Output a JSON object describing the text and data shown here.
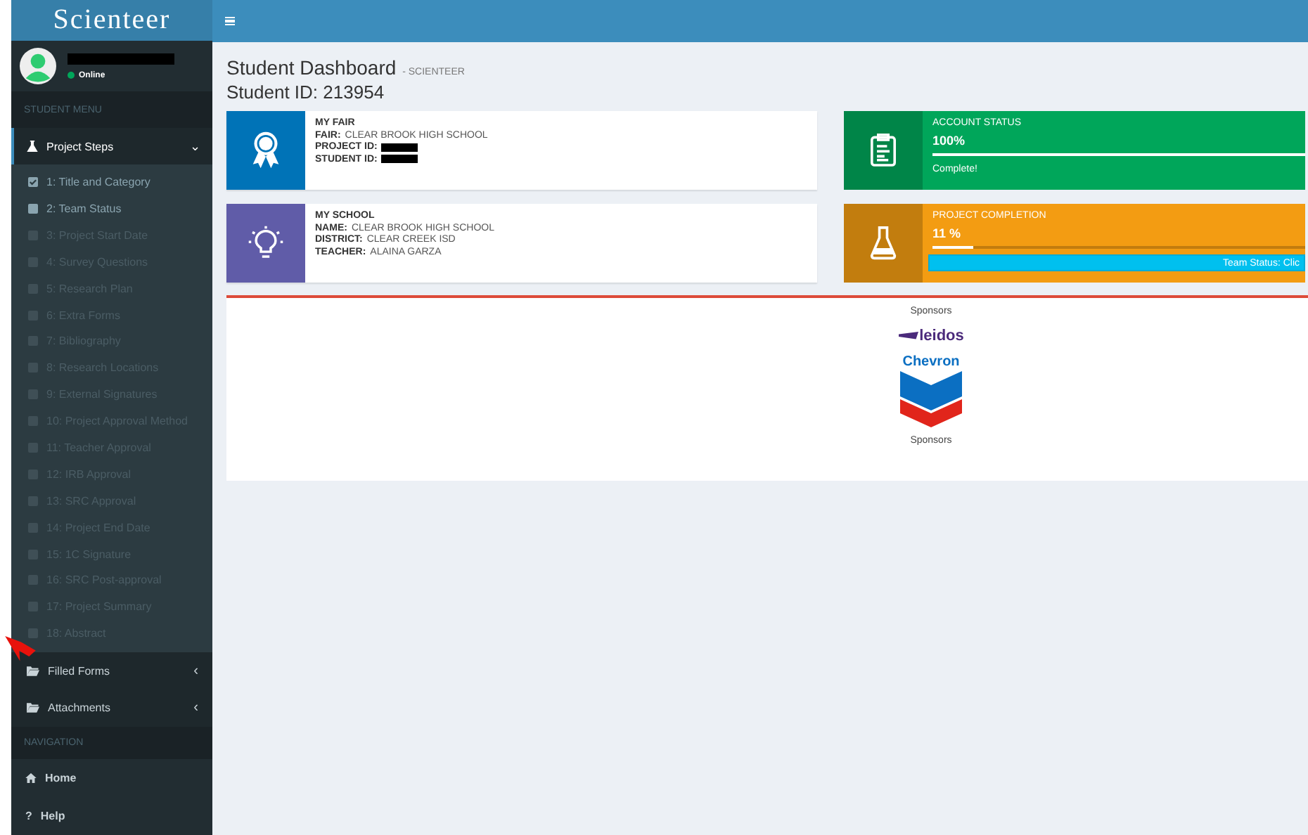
{
  "brand": "Scienteer",
  "user": {
    "status": "Online"
  },
  "sidebar": {
    "menu_header": "STUDENT MENU",
    "group": {
      "label": "Project Steps",
      "expanded": true,
      "caret": "⌄"
    },
    "steps": [
      {
        "label": "1: Title and Category",
        "checked": true,
        "disabled": false
      },
      {
        "label": "2: Team Status",
        "checked": false,
        "disabled": false
      },
      {
        "label": "3: Project Start Date",
        "checked": false,
        "disabled": true
      },
      {
        "label": "4: Survey Questions",
        "checked": false,
        "disabled": true
      },
      {
        "label": "5: Research Plan",
        "checked": false,
        "disabled": true
      },
      {
        "label": "6: Extra Forms",
        "checked": false,
        "disabled": true
      },
      {
        "label": "7: Bibliography",
        "checked": false,
        "disabled": true
      },
      {
        "label": "8: Research Locations",
        "checked": false,
        "disabled": true
      },
      {
        "label": "9: External Signatures",
        "checked": false,
        "disabled": true
      },
      {
        "label": "10: Project Approval Method",
        "checked": false,
        "disabled": true
      },
      {
        "label": "11: Teacher Approval",
        "checked": false,
        "disabled": true
      },
      {
        "label": "12: IRB Approval",
        "checked": false,
        "disabled": true
      },
      {
        "label": "13: SRC Approval",
        "checked": false,
        "disabled": true
      },
      {
        "label": "14: Project End Date",
        "checked": false,
        "disabled": true
      },
      {
        "label": "15: 1C Signature",
        "checked": false,
        "disabled": true
      },
      {
        "label": "16: SRC Post-approval",
        "checked": false,
        "disabled": true
      },
      {
        "label": "17: Project Summary",
        "checked": false,
        "disabled": true
      },
      {
        "label": "18: Abstract",
        "checked": false,
        "disabled": true
      }
    ],
    "folders": [
      {
        "label": "Filled Forms",
        "caret": "‹"
      },
      {
        "label": "Attachments",
        "caret": "‹"
      }
    ],
    "nav_header": "NAVIGATION",
    "nav": [
      {
        "kind": "home",
        "label": "Home"
      },
      {
        "kind": "help",
        "icon": "?",
        "label": "Help"
      }
    ]
  },
  "page": {
    "title": "Student Dashboard",
    "subtitle": "- SCIENTEER",
    "student_id_label": "Student ID:",
    "student_id": "213954"
  },
  "info_boxes": [
    {
      "kind": "fair",
      "color": "#0073b7",
      "title": "MY FAIR",
      "lines": [
        {
          "label": "FAIR:",
          "value": "CLEAR BROOK HIGH SCHOOL"
        },
        {
          "label": "PROJECT ID:",
          "redacted": true
        },
        {
          "label": "STUDENT ID:",
          "redacted": true
        }
      ]
    },
    {
      "kind": "school",
      "color": "#605ca8",
      "title": "MY SCHOOL",
      "lines": [
        {
          "label": "NAME:",
          "value": "CLEAR BROOK HIGH SCHOOL"
        },
        {
          "label": "DISTRICT:",
          "value": "CLEAR CREEK ISD"
        },
        {
          "label": "TEACHER:",
          "value": "ALAINA GARZA"
        }
      ]
    }
  ],
  "status_boxes": [
    {
      "kind": "clipboard",
      "color": "#00a65a",
      "title": "ACCOUNT STATUS",
      "value": "100%",
      "level": 1,
      "footer": "Complete!"
    },
    {
      "kind": "flask",
      "color": "#f39c12",
      "title": "PROJECT COMPLETION",
      "value": "11 %",
      "level": 0.11,
      "button": "Team Status: Clic"
    }
  ],
  "sponsors": {
    "heading": "Sponsors",
    "logos": [
      {
        "kind": "leidos",
        "text": "leidos"
      },
      {
        "kind": "chevron",
        "text": "Chevron"
      }
    ],
    "footer": "Sponsors"
  }
}
